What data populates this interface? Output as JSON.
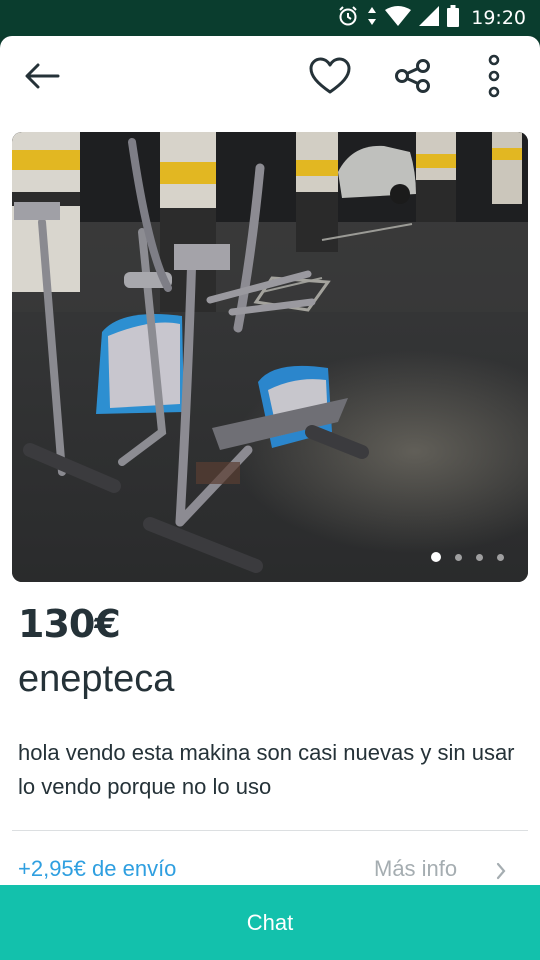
{
  "status_bar": {
    "time": "19:20",
    "icons": [
      "alarm-icon",
      "data-arrows-icon",
      "wifi-icon",
      "signal-icon",
      "battery-icon"
    ]
  },
  "toolbar": {
    "back_icon": "arrow-left-icon",
    "favorite_icon": "heart-icon",
    "share_icon": "share-icon",
    "more_icon": "more-vertical-icon"
  },
  "gallery": {
    "image_description": "elliptical exercise machine and stationary bike in a parking garage",
    "photo_count": 4,
    "active_index": 0
  },
  "product": {
    "price": "130€",
    "title": "enepteca",
    "description": "hola vendo esta makina son casi nuevas y sin usar lo vendo porque no lo uso"
  },
  "shipping": {
    "label": "+2,95€ de envío",
    "more_info_label": "Más info"
  },
  "chat": {
    "label": "Chat"
  },
  "colors": {
    "accent": "#13c1ac",
    "link": "#2f9fe0",
    "text": "#253238",
    "status_bar": "#0a3d2e"
  }
}
